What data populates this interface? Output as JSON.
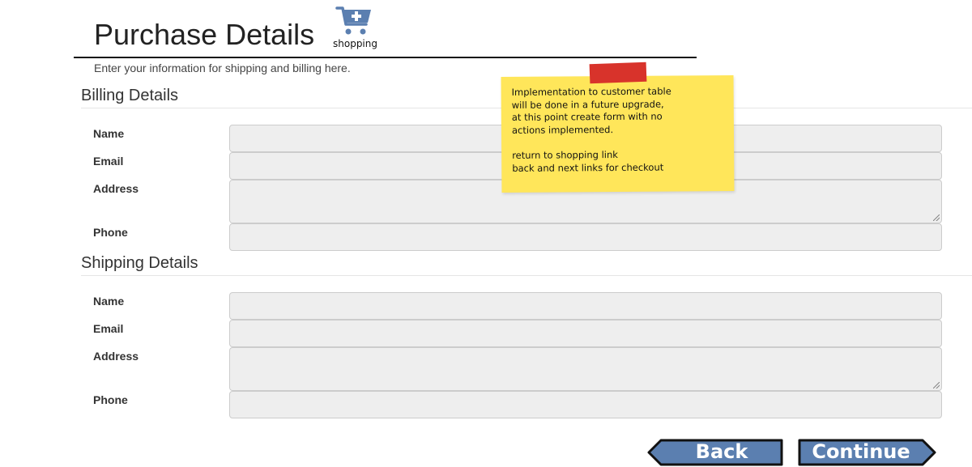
{
  "header": {
    "title": "Purchase Details",
    "cart_caption": "shopping",
    "subtitle": "Enter your information for shipping and billing here."
  },
  "billing": {
    "heading": "Billing Details",
    "name_label": "Name",
    "email_label": "Email",
    "address_label": "Address",
    "phone_label": "Phone"
  },
  "shipping": {
    "heading": "Shipping Details",
    "name_label": "Name",
    "email_label": "Email",
    "address_label": "Address",
    "phone_label": "Phone"
  },
  "note": {
    "lines": [
      "Implementation to customer table",
      "will be done in a future upgrade,",
      "at this point create form with no",
      "actions implemented.",
      "return to shopping link",
      "back and next links for checkout"
    ]
  },
  "buttons": {
    "back_label": "Back",
    "continue_label": "Continue"
  },
  "colors": {
    "button_fill": "#5b7fb0",
    "button_outline": "#111111",
    "cart_icon": "#5b7fb0",
    "sticky_note": "#ffe65a",
    "sticky_tape": "#d8332b",
    "input_fill": "#eeeeee"
  },
  "icons": {
    "cart": "shopping-cart-plus-icon"
  }
}
